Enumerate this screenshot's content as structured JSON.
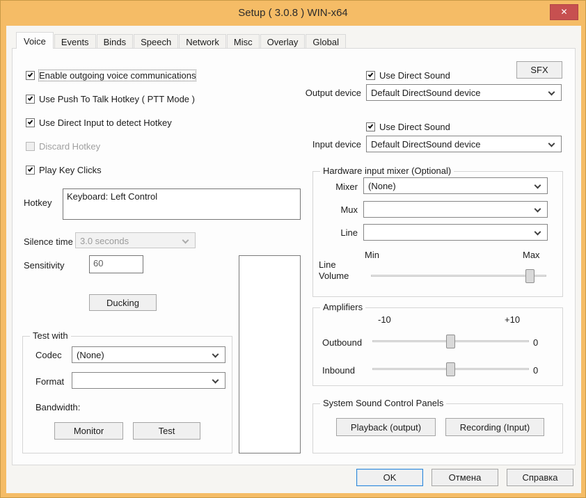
{
  "window": {
    "title": "Setup ( 3.0.8 ) WIN-x64",
    "close_glyph": "✕"
  },
  "tabs": [
    "Voice",
    "Events",
    "Binds",
    "Speech",
    "Network",
    "Misc",
    "Overlay",
    "Global"
  ],
  "voice": {
    "checkboxes": {
      "enable_outgoing": "Enable outgoing voice communications",
      "ptt": "Use Push To Talk Hotkey ( PTT Mode )",
      "direct_input": "Use Direct Input to detect Hotkey",
      "discard_hotkey": "Discard Hotkey",
      "play_key_clicks": "Play Key Clicks"
    },
    "hotkey": {
      "label": "Hotkey",
      "value": "Keyboard: Left Control"
    },
    "silence_time": {
      "label": "Silence time",
      "value": "3.0 seconds"
    },
    "sensitivity": {
      "label": "Sensitivity",
      "value": "60"
    },
    "ducking_button": "Ducking",
    "test_with": {
      "title": "Test with",
      "codec_label": "Codec",
      "codec_value": "(None)",
      "format_label": "Format",
      "format_value": "",
      "bandwidth_label": "Bandwidth:",
      "monitor_button": "Monitor",
      "test_button": "Test"
    },
    "output": {
      "use_direct_sound": "Use Direct Sound",
      "sfx_button": "SFX",
      "device_label": "Output device",
      "device_value": "Default DirectSound device"
    },
    "input": {
      "use_direct_sound": "Use Direct Sound",
      "device_label": "Input device",
      "device_value": "Default DirectSound device"
    },
    "mixer_group": {
      "title": "Hardware input mixer (Optional)",
      "mixer_label": "Mixer",
      "mixer_value": "(None)",
      "mux_label": "Mux",
      "mux_value": "",
      "line_label": "Line",
      "line_value": "",
      "min_label": "Min",
      "max_label": "Max",
      "line_volume_label": "Line Volume"
    },
    "amplifiers": {
      "title": "Amplifiers",
      "scale_min": "-10",
      "scale_max": "+10",
      "outbound_label": "Outbound",
      "outbound_value": "0",
      "inbound_label": "Inbound",
      "inbound_value": "0"
    },
    "sound_panels": {
      "title": "System Sound Control Panels",
      "playback_button": "Playback (output)",
      "recording_button": "Recording (Input)"
    }
  },
  "footer": {
    "ok": "OK",
    "cancel": "Отмена",
    "help": "Справка"
  }
}
